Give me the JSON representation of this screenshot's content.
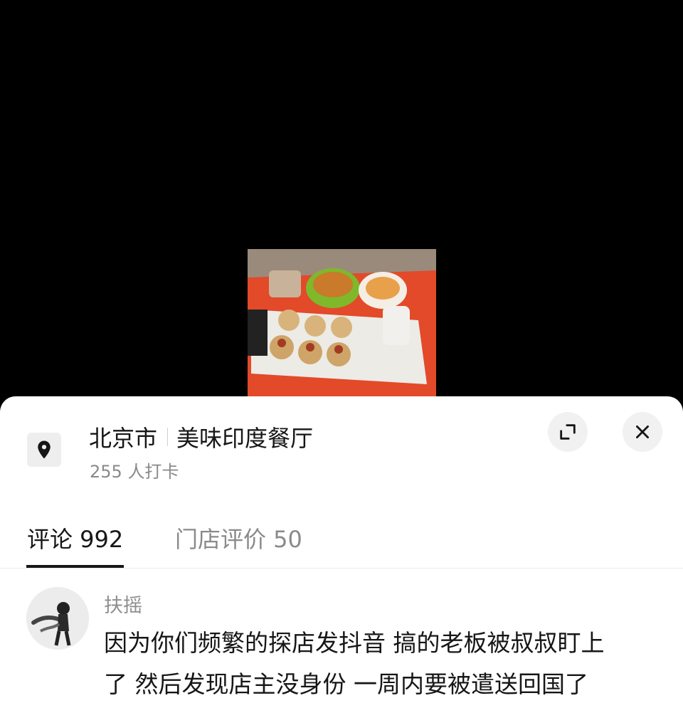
{
  "location": {
    "city": "北京市",
    "name": "美味印度餐厅",
    "checkins": "255 人打卡"
  },
  "tabs": [
    {
      "label": "评论 992",
      "active": true
    },
    {
      "label": "门店评价 50",
      "active": false
    }
  ],
  "comment": {
    "username": "扶摇",
    "line1": "因为你们频繁的探店发抖音 搞的老板被叔叔盯上",
    "line2": "了 然后发现店主没身份 一周内要被遣送回国了"
  },
  "icons": {
    "location": "location-pin-icon",
    "expand": "expand-icon",
    "close": "close-icon"
  },
  "colors": {
    "tray": "#e24a2a",
    "text": "#161616",
    "muted": "#8a8a8a"
  }
}
